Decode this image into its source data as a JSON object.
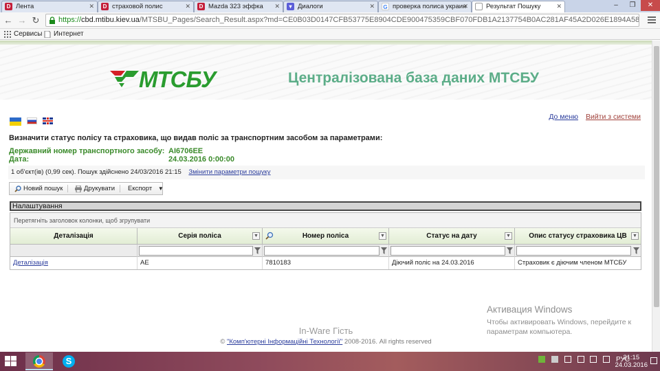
{
  "browser": {
    "tabs": [
      {
        "label": "Лента",
        "icon_letter": "D",
        "icon_color": "#c41e3a"
      },
      {
        "label": "страховой полис",
        "icon_letter": "D",
        "icon_color": "#c41e3a"
      },
      {
        "label": "Mazda 323 эффка",
        "icon_letter": "D",
        "icon_color": "#c41e3a"
      },
      {
        "label": "Диалоги",
        "icon_letter": "",
        "icon_color": "#5b5ed8"
      },
      {
        "label": "проверка полиса украин",
        "icon_letter": "G",
        "icon_color": "#4285f4"
      },
      {
        "label": "Результат Пошуку",
        "icon_letter": "",
        "icon_color": "#ffffff"
      }
    ],
    "url_scheme": "https://",
    "url_host": "cbd.mtibu.kiev.ua",
    "url_path": "/MTSBU_Pages/Search_Result.aspx?md=CE0B03D0147CFB53775E8904CDE900475359CBF070FDB1A2137754B0AC281AF45A2D026E1894A58",
    "bookmarks": [
      "Сервисы",
      "Интернет"
    ]
  },
  "header": {
    "logo_text": "МТСБУ",
    "site_title": "Централізована база даних МТСБУ",
    "brand_color": "#2a9c2f",
    "title_color": "#5cad88"
  },
  "nav": {
    "languages": [
      "ua",
      "ru",
      "en"
    ],
    "menu_link": "До меню",
    "logout_link": "Вийти з системи"
  },
  "query": {
    "title": "Визначити статус полісу та страховика, що видав поліс за транспортним засобом за параметрами:",
    "plate_label": "Державний номер транспортного засобу:",
    "plate_value": "АІ6706ЕЕ",
    "date_label": "Дата:",
    "date_value": "24.03.2016 0:00:00"
  },
  "infobar": {
    "text": "1 об'єкт(ів) (0,99 сек). Пошук здійснено 24/03/2016 21:15",
    "change_link": "Змінити параметри пошуку"
  },
  "toolbar": {
    "new_search": "Новий пошук",
    "print": "Друкувати",
    "export": "Експорт"
  },
  "grid": {
    "settings_label": "Налаштування",
    "group_hint": "Перетягніть заголовок колонки, щоб згрупувати",
    "columns": [
      "Деталізація",
      "Серія поліса",
      "Номер поліса",
      "Статус на дату",
      "Опис статусу страховика ЦВ"
    ],
    "rows": [
      [
        "Деталізація",
        "АЕ",
        "7810183",
        "Діючий поліс на 24.03.2016",
        "Страховик є діючим членом МТСБУ"
      ]
    ]
  },
  "footer": {
    "brand": "In-Ware Гість",
    "copy_prefix": "©",
    "copy_link": "\"Комп'ютерні Інформаційні Технології\"",
    "copy_suffix": "2008-2016. All rights reserved"
  },
  "watermark": {
    "line1": "Активация Windows",
    "line2": "Чтобы активировать Windows, перейдите к",
    "line3": "параметрам компьютера."
  },
  "taskbar": {
    "lang": "РУС",
    "time": "21:15",
    "date": "24.03.2016"
  }
}
